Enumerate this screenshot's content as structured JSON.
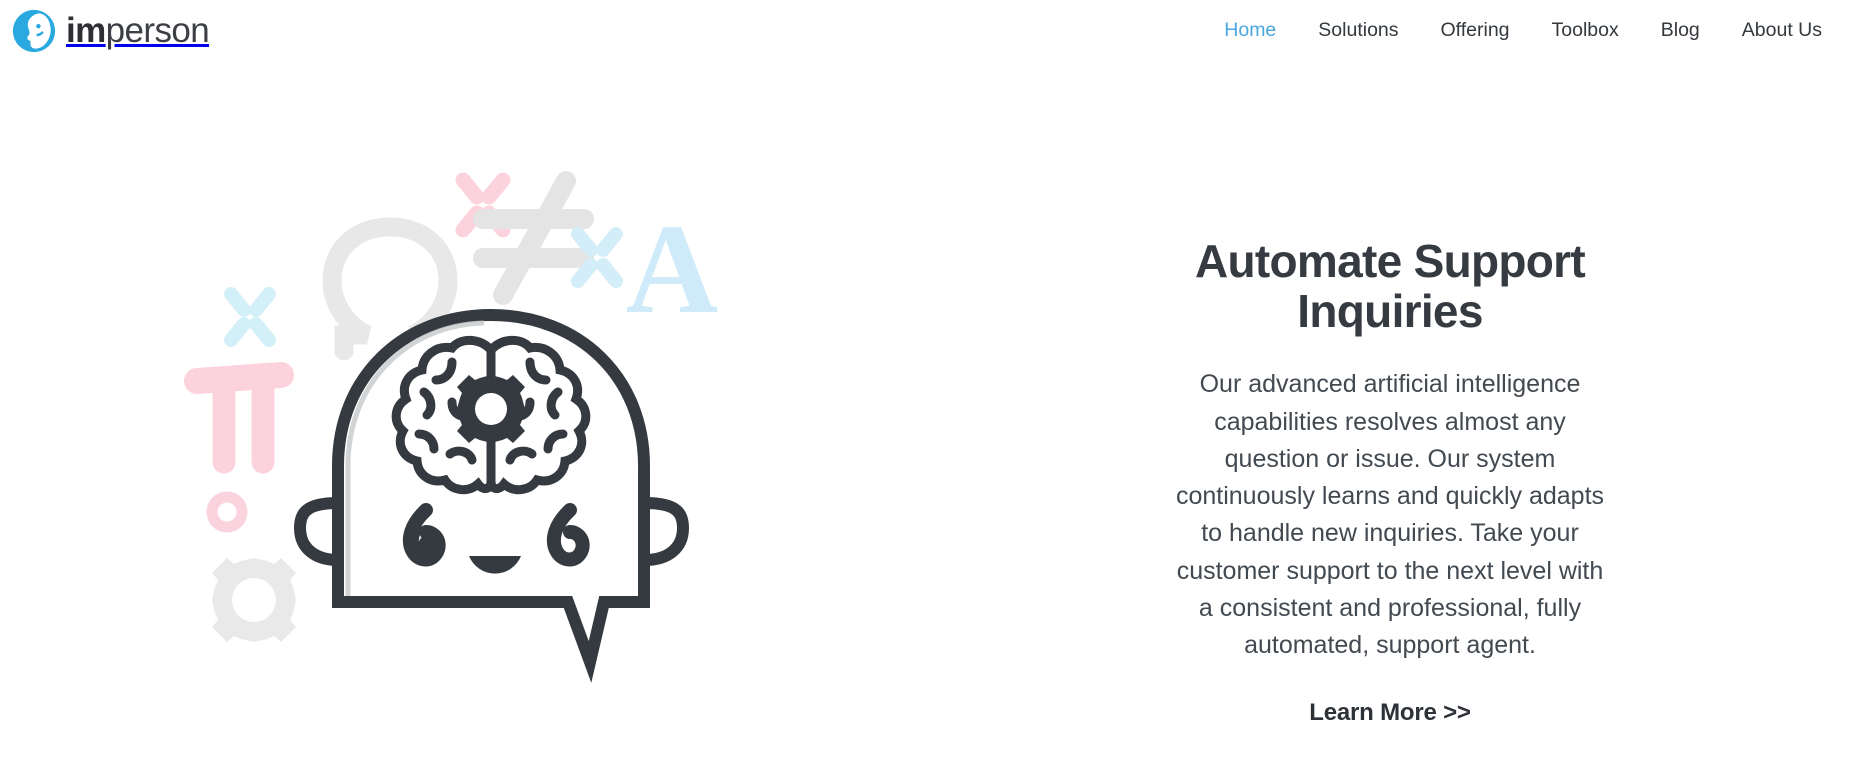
{
  "brand": {
    "logo_icon": "face-profile-circle-logo-icon",
    "name_bold": "im",
    "name_light": "person",
    "logo_color": "#29a9e0"
  },
  "nav": {
    "items": [
      {
        "label": "Home",
        "active": true
      },
      {
        "label": "Solutions",
        "active": false
      },
      {
        "label": "Offering",
        "active": false
      },
      {
        "label": "Toolbox",
        "active": false
      },
      {
        "label": "Blog",
        "active": false
      },
      {
        "label": "About Us",
        "active": false
      }
    ],
    "active_color": "#4aa6e0",
    "inactive_color": "#33383d"
  },
  "hero": {
    "title": "Automate Support Inquiries",
    "description": "Our advanced artificial intelligence capabilities resolves almost any question or issue. Our system continuously learns and quickly adapts to handle new inquiries. Take your customer support to the next level with a consistent and professional, fully automated, support agent.",
    "cta_label": "Learn More >>",
    "illustration": {
      "name": "ai-chatbot-brain-speech-bubble-illustration",
      "main_stroke_color": "#343a40",
      "decorations": [
        {
          "name": "sparkle-pink-top",
          "symbol": "sparkle",
          "color": "#fcd2dd"
        },
        {
          "name": "omega-gray",
          "symbol": "Ω",
          "color": "#e8e8e8"
        },
        {
          "name": "not-equal-gray",
          "symbol": "≠",
          "color": "#e4e4e4"
        },
        {
          "name": "sparkle-blue-right",
          "symbol": "sparkle",
          "color": "#d3eef8"
        },
        {
          "name": "letter-a-blue",
          "symbol": "A",
          "color": "#cfeaf8"
        },
        {
          "name": "sparkle-blue-left",
          "symbol": "sparkle",
          "color": "#d3f0f8"
        },
        {
          "name": "pi-pink",
          "symbol": "π",
          "color": "#fcd3dd"
        },
        {
          "name": "ring-pink",
          "symbol": "○",
          "color": "#fbd3de"
        },
        {
          "name": "gear-gray",
          "symbol": "gear",
          "color": "#e9e9e9"
        }
      ]
    }
  }
}
